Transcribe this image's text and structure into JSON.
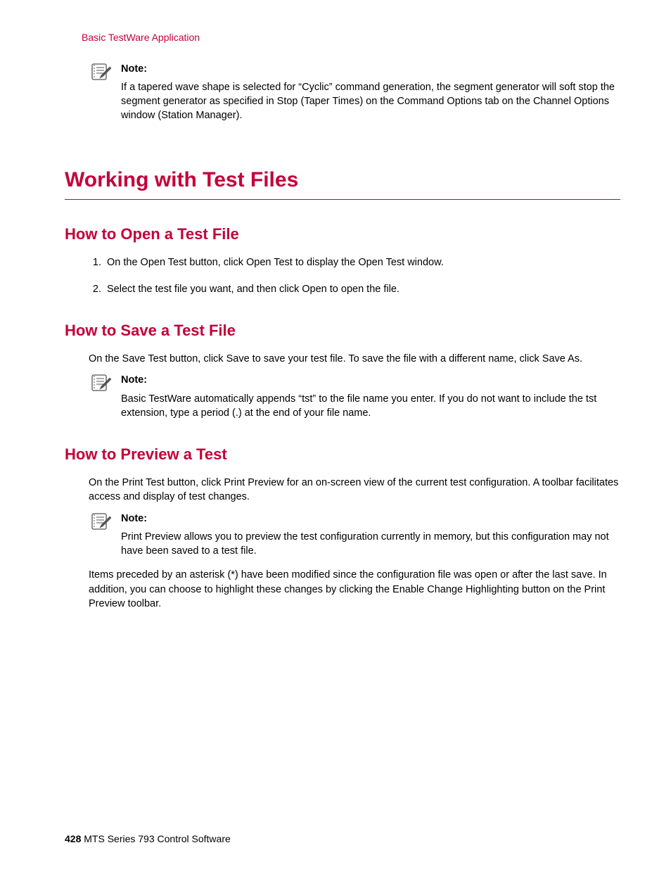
{
  "breadcrumb": "Basic TestWare Application",
  "note1": {
    "label": "Note:",
    "text": "If a tapered wave shape is selected for “Cyclic” command generation, the segment generator will soft stop the segment generator as specified in Stop (Taper Times) on the Command Options tab on the Channel Options window (Station Manager)."
  },
  "sectionTitle": "Working with Test Files",
  "sub1": {
    "title": "How to Open a Test File",
    "step1": "On the Open Test button, click Open Test to display the Open Test window.",
    "step2": "Select the test file you want, and then click Open to open the file."
  },
  "sub2": {
    "title": "How to Save a Test File",
    "intro": "On the Save Test button, click Save to save your test file. To save the file with a different name, click Save As.",
    "note": {
      "label": "Note:",
      "text": "Basic TestWare automatically appends “tst” to the file name you enter. If you do not want to include the tst extension, type a period (.) at the end of your file name."
    }
  },
  "sub3": {
    "title": "How to Preview a Test",
    "intro": "On the Print Test button, click Print Preview for an on-screen view of the current test configuration. A toolbar facilitates access and display of test changes.",
    "note": {
      "label": "Note:",
      "text": "Print Preview allows you to preview the test configuration currently in memory, but this configuration may not have been saved to a test file."
    },
    "after": "Items preceded by an asterisk (*) have been modified since the configuration file was open or after the last save. In addition, you can choose to highlight these changes by clicking the Enable Change Highlighting button on the Print Preview toolbar."
  },
  "footer": {
    "page": "428",
    "doc": " MTS Series 793 Control Software"
  }
}
